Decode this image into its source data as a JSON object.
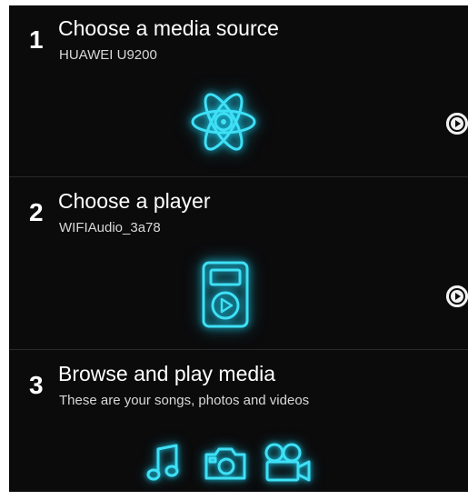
{
  "steps": [
    {
      "number": "1",
      "title": "Choose a media source",
      "subtitle": "HUAWEI U9200",
      "icon": "atom-icon"
    },
    {
      "number": "2",
      "title": "Choose a player",
      "subtitle": "WIFIAudio_3a78",
      "icon": "media-player-icon"
    },
    {
      "number": "3",
      "title": "Browse and play media",
      "subtitle": "These are your songs, photos and videos",
      "icons": [
        "music-note-icon",
        "camera-icon",
        "video-camera-icon"
      ]
    }
  ],
  "colors": {
    "background": "#0b0b0c",
    "accent_glow": "#19c6e6",
    "text_primary": "#ffffff",
    "text_secondary": "#d8d8d8"
  }
}
